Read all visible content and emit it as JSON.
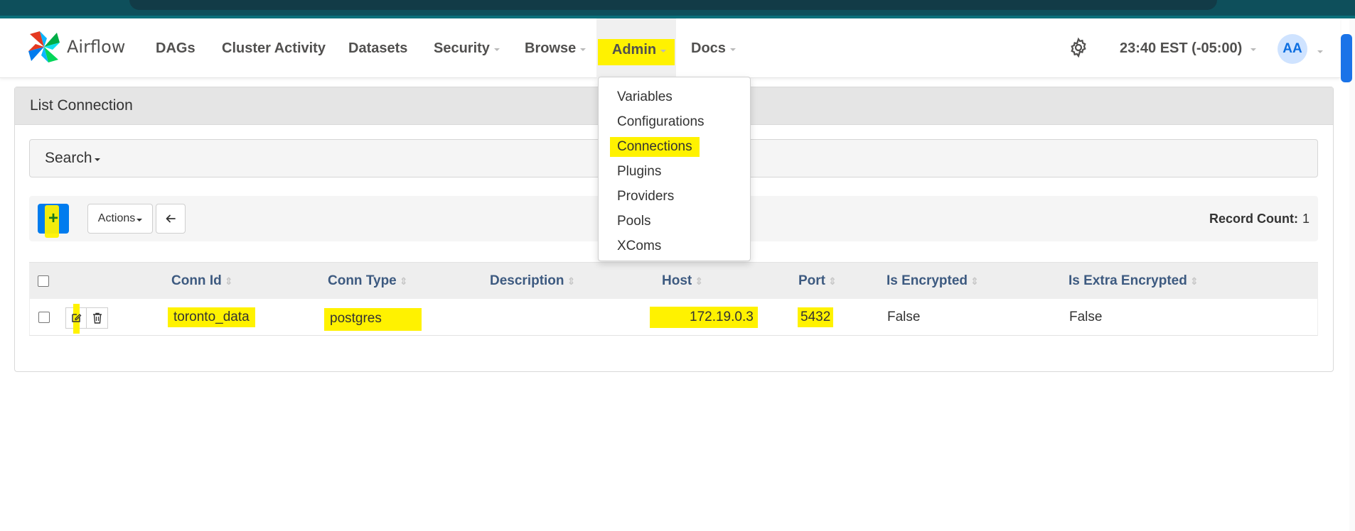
{
  "brand": {
    "name": "Airflow"
  },
  "nav": {
    "dags": "DAGs",
    "cluster_activity": "Cluster Activity",
    "datasets": "Datasets",
    "security": "Security",
    "browse": "Browse",
    "admin": "Admin",
    "docs": "Docs",
    "clock": "23:40 EST (-05:00)",
    "avatar": "AA"
  },
  "admin_menu": {
    "items": [
      "Variables",
      "Configurations",
      "Connections",
      "Plugins",
      "Providers",
      "Pools",
      "XComs"
    ]
  },
  "panel": {
    "title": "List Connection",
    "search_label": "Search",
    "actions_label": "Actions",
    "add_label": "+",
    "record_count_label": "Record Count:",
    "record_count_value": "1"
  },
  "table": {
    "columns": [
      "Conn Id",
      "Conn Type",
      "Description",
      "Host",
      "Port",
      "Is Encrypted",
      "Is Extra Encrypted"
    ],
    "rows": [
      {
        "conn_id": "toronto_data",
        "conn_type": "postgres",
        "description": "",
        "host": "172.19.0.3",
        "port": "5432",
        "is_encrypted": "False",
        "is_extra_encrypted": "False"
      }
    ]
  },
  "colors": {
    "primary": "#017cee",
    "highlight": "#fff200",
    "header_text": "#3d5a80",
    "nav_text": "#51504f"
  },
  "icons": [
    "airflow-logo-icon",
    "gear-icon",
    "back-arrow-icon",
    "edit-icon",
    "trash-icon",
    "sort-icon",
    "caret-down-icon"
  ]
}
